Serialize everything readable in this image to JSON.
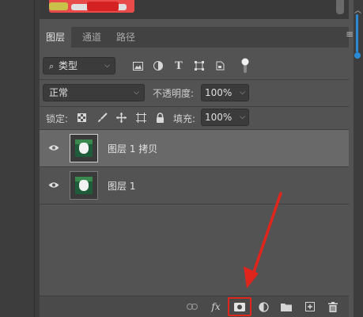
{
  "tabs": [
    {
      "label": "图层",
      "active": true
    },
    {
      "label": "通道",
      "active": false
    },
    {
      "label": "路径",
      "active": false
    }
  ],
  "filter": {
    "kind_label": "类型",
    "icons": [
      "image-filter-icon",
      "adjustment-filter-icon",
      "type-filter-icon",
      "shape-filter-icon",
      "smart-object-filter-icon",
      "filter-toggle-icon"
    ]
  },
  "blend": {
    "mode": "正常",
    "opacity_label": "不透明度:",
    "opacity_value": "100%"
  },
  "lock": {
    "label": "锁定:",
    "icons": [
      "lock-transparent-icon",
      "lock-image-icon",
      "lock-position-icon",
      "lock-artboard-icon",
      "lock-all-icon"
    ],
    "fill_label": "填充:",
    "fill_value": "100%"
  },
  "layers": [
    {
      "name": "图层 1 拷贝",
      "selected": true,
      "visible": true
    },
    {
      "name": "图层 1",
      "selected": false,
      "visible": true
    }
  ],
  "bottom_bar": {
    "fx_label": "fx",
    "icons": [
      "link-layers-icon",
      "layer-style-icon",
      "add-mask-icon",
      "adjustment-layer-icon",
      "new-group-icon",
      "new-layer-icon",
      "delete-layer-icon"
    ]
  },
  "colors": {
    "highlight": "#e0261c",
    "accent": "#2c8ad4"
  }
}
